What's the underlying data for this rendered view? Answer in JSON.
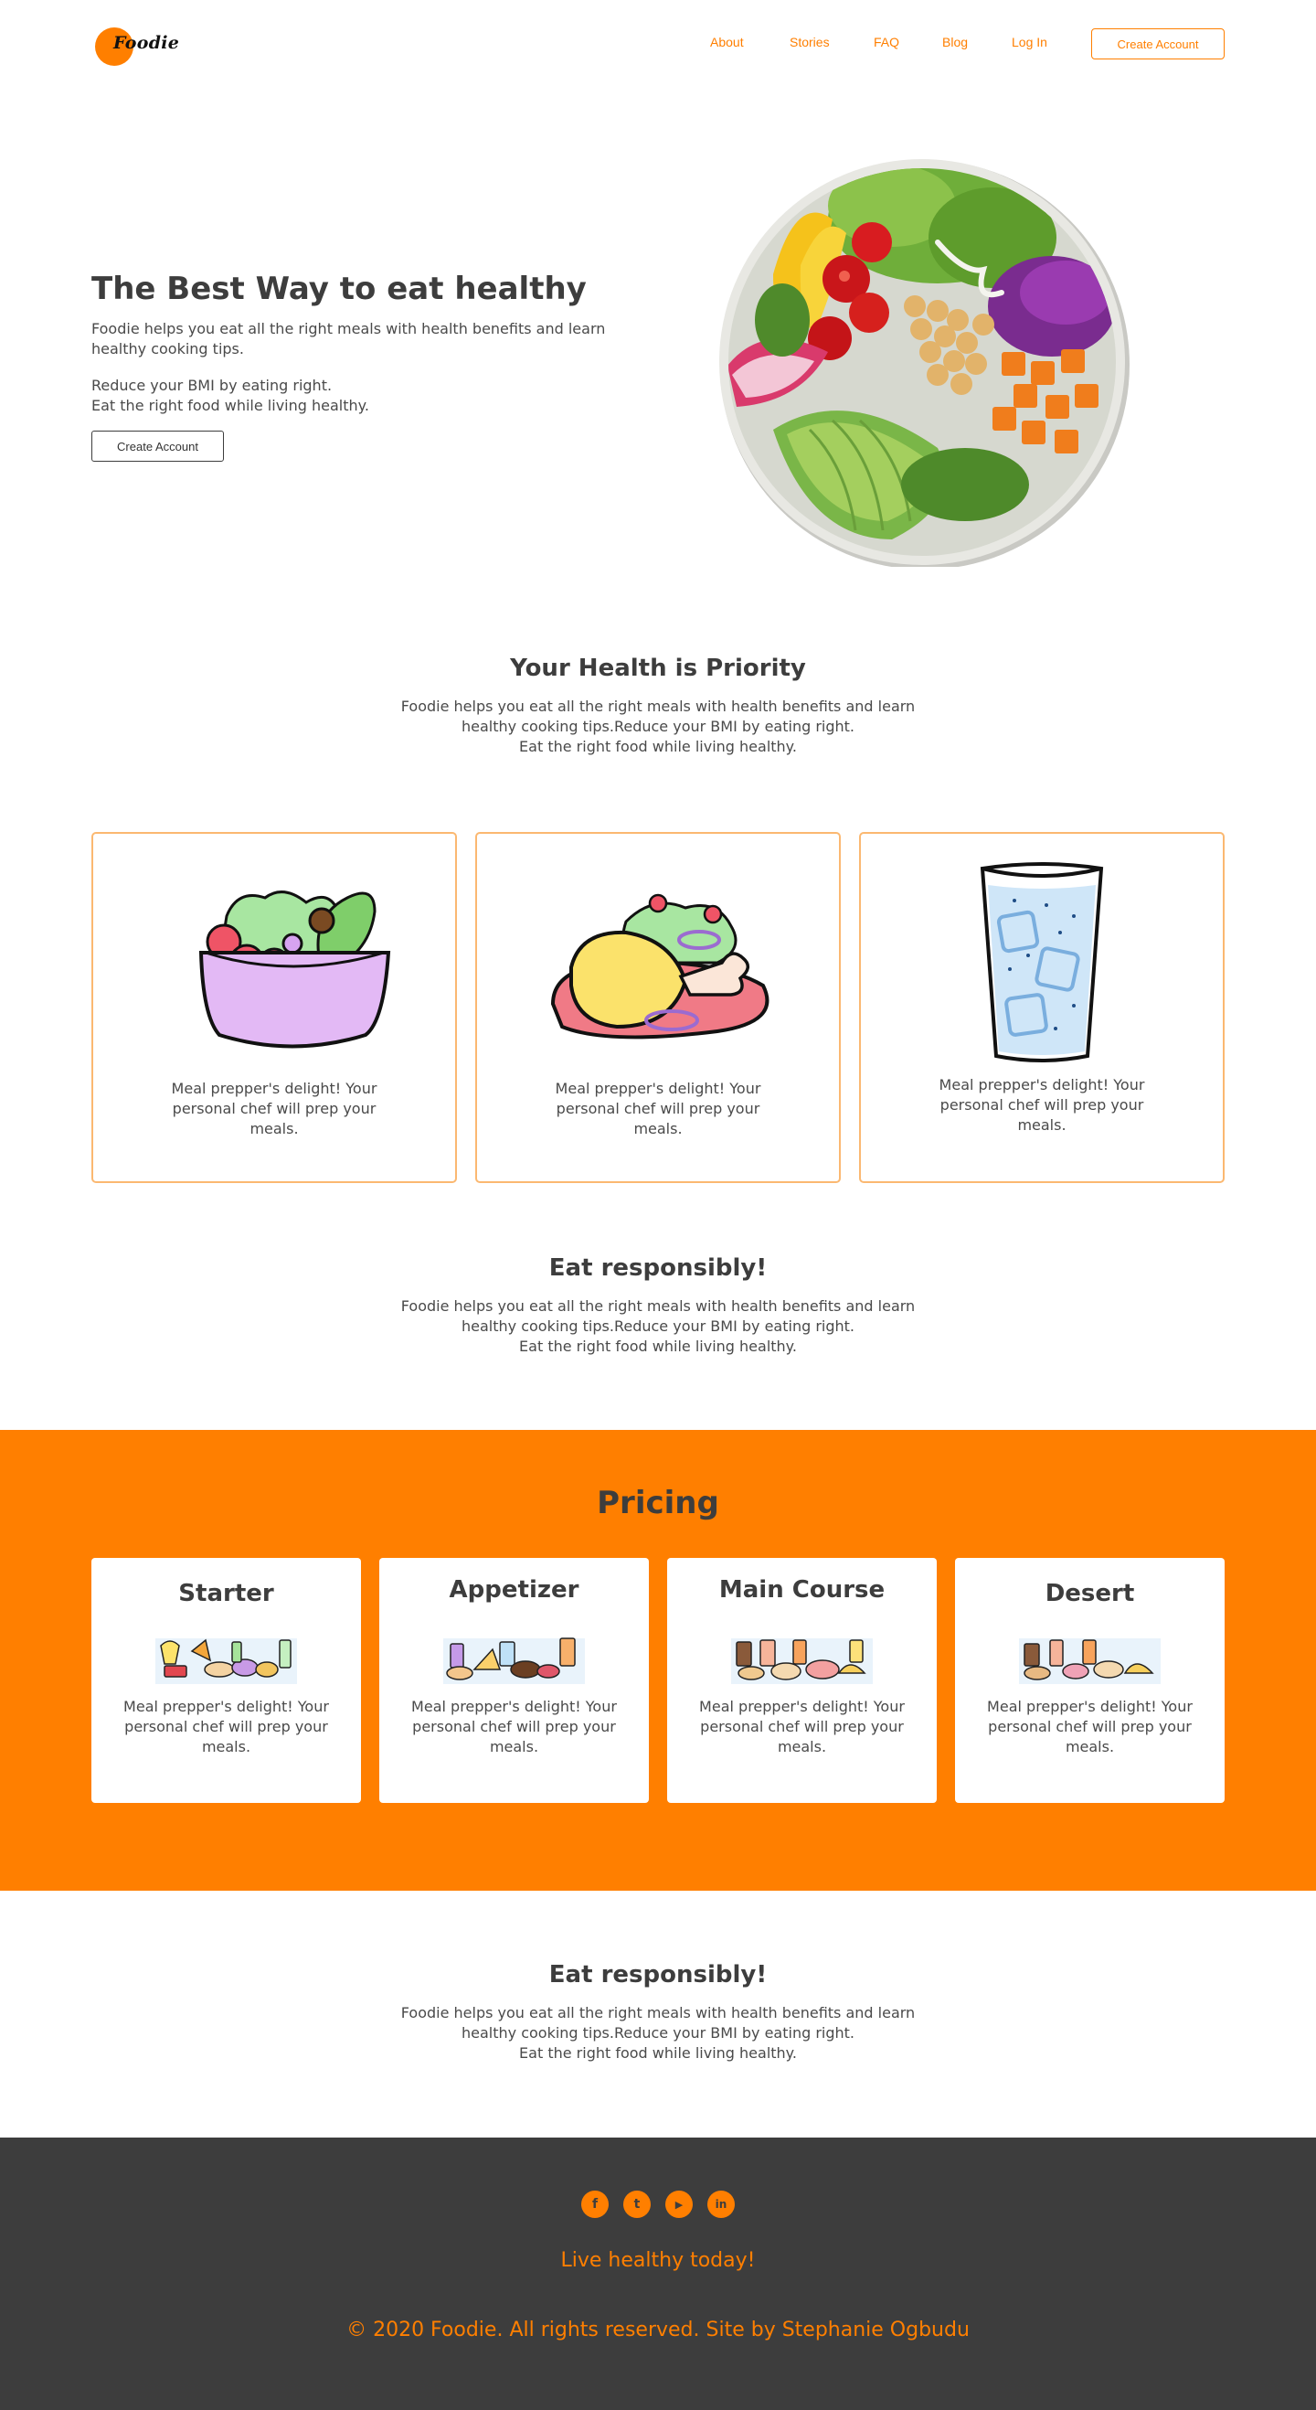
{
  "brand": {
    "name": "Foodie",
    "accent": "#ff7f00",
    "dark": "#3d3d3d",
    "card_border": "#fbb871"
  },
  "nav": {
    "links": [
      "About",
      "Stories",
      "FAQ",
      "Blog",
      "Log In"
    ],
    "cta": "Create Account"
  },
  "hero": {
    "title": "The Best Way to eat healthy",
    "p1_line1": "Foodie helps you eat all the right meals with health benefits and learn",
    "p1_line2": "healthy cooking tips.",
    "p2_line1": "Reduce your BMI by eating right.",
    "p2_line2": "Eat the right food while living healthy.",
    "cta": "Create Account",
    "image": "salad-bowl-photo"
  },
  "health": {
    "title": "Your Health is Priority",
    "line1": "Foodie helps you eat all the right meals with health benefits and learn",
    "line2": "healthy cooking tips.Reduce your BMI by eating right.",
    "line3": "Eat the right food while living healthy."
  },
  "features": [
    {
      "icon": "salad-bowl-illustration",
      "line1": "Meal prepper's delight! Your",
      "line2": "personal chef will prep your",
      "line3": "meals."
    },
    {
      "icon": "chicken-plate-illustration",
      "line1": "Meal prepper's delight! Your",
      "line2": "personal chef will prep your",
      "line3": "meals."
    },
    {
      "icon": "water-glass-illustration",
      "line1": "Meal prepper's delight! Your",
      "line2": "personal chef will prep your",
      "line3": "meals."
    }
  ],
  "responsible1": {
    "title": "Eat responsibly!",
    "line1": "Foodie helps you eat all the right meals with health benefits and learn",
    "line2": "healthy cooking tips.Reduce your BMI by eating right.",
    "line3": "Eat the right food while living healthy."
  },
  "pricing": {
    "title": "Pricing",
    "plans": [
      {
        "name": "Starter",
        "line1": "Meal prepper's delight! Your",
        "line2": "personal chef will prep your",
        "line3": "meals."
      },
      {
        "name": "Appetizer",
        "line1": "Meal prepper's delight! Your",
        "line2": "personal chef will prep your",
        "line3": "meals."
      },
      {
        "name": "Main Course",
        "line1": "Meal prepper's delight! Your",
        "line2": "personal chef will prep your",
        "line3": "meals."
      },
      {
        "name": "Desert",
        "line1": "Meal prepper's delight! Your",
        "line2": "personal chef will prep your",
        "line3": "meals."
      }
    ]
  },
  "responsible2": {
    "title": "Eat responsibly!",
    "line1": "Foodie helps you eat all the right meals with health benefits and learn",
    "line2": "healthy cooking tips.Reduce your BMI by eating right.",
    "line3": "Eat the right food while living healthy."
  },
  "footer": {
    "social_icons": [
      "facebook-icon",
      "twitter-icon",
      "youtube-icon",
      "linkedin-icon"
    ],
    "social_glyphs": [
      "f",
      "t",
      "▶",
      "in"
    ],
    "tagline": "Live healthy today!",
    "copyright": "© 2020 Foodie. All rights reserved. Site by Stephanie Ogbudu"
  }
}
